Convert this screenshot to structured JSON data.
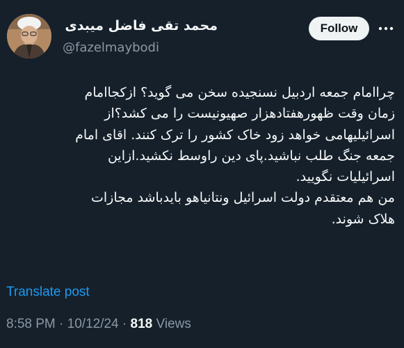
{
  "author": {
    "display_name": "محمد تقی فاضل میبدی",
    "handle": "@fazelmaybodi",
    "avatar": "avatar-photo"
  },
  "actions": {
    "follow_label": "Follow",
    "more_icon": "more-dots-icon"
  },
  "tweet": {
    "lines": [
      "چراامام جمعه اردبیل نسنجیده سخن می گوید؟ ازکجاامام",
      "زمان وقت ظهورهفتادهزار صهیونیست را می کشد؟از",
      "اسرائیلیهامی خواهد زود خاک کشور را ترک کنند. اقای امام",
      "جمعه جنگ طلب نباشید.پای دین راوسط نکشید.ازاین",
      "اسرائیلیات نگویید.",
      "من هم معتقدم دولت اسرائیل ونتانیاهو بایدباشد مجازات",
      "هلاک شوند."
    ],
    "translate_label": "Translate post"
  },
  "meta": {
    "time": "8:58 PM",
    "separator": "·",
    "date": "10/12/24",
    "views_count": "818",
    "views_label": "Views"
  },
  "colors": {
    "background": "#15202b",
    "text": "#f7f9f9",
    "secondary": "#8b98a5",
    "link": "#1d9bf0",
    "button_bg": "#eff3f4"
  }
}
